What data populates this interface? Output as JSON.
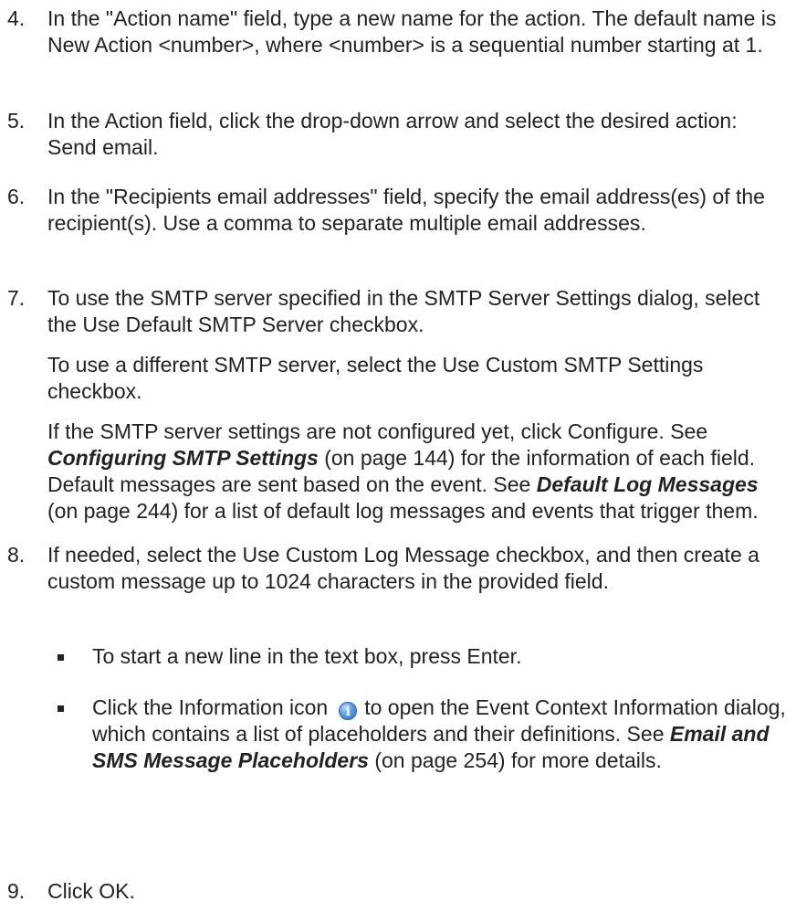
{
  "steps": [
    {
      "num": "4.",
      "paragraphs": [
        "In the \"Action name\" field, type a new name for the action. The default name is New Action <number>, where <number> is a sequential number starting at 1."
      ]
    },
    {
      "num": "5.",
      "paragraphs": [
        "In the Action field, click the drop-down arrow and select the desired action: Send email."
      ]
    },
    {
      "num": "6.",
      "paragraphs": [
        "In the \"Recipients email addresses\" field, specify the email address(es) of the recipient(s). Use a comma to separate multiple email addresses."
      ]
    },
    {
      "num": "7.",
      "paragraphs": [
        "To use the SMTP server specified in the SMTP Server Settings dialog, select the Use Default SMTP Server checkbox.",
        "To use a different SMTP server, select the Use Custom SMTP Settings checkbox."
      ],
      "config_para": {
        "t1": "If the SMTP server settings are not configured yet, click Configure. See ",
        "link1": "Configuring SMTP Settings",
        "t2": " (on page 144) for the information of each field. Default messages are sent based on the event. See ",
        "link2": "Default Log Messages",
        "t3": " (on page 244) for a list of default log messages and events that trigger them."
      }
    },
    {
      "num": "8.",
      "paragraphs": [
        "If needed, select the Use Custom Log Message checkbox, and then create a custom message up to 1024 characters in the provided field."
      ],
      "bullets": {
        "b1": "To start a new line in the text box, press Enter.",
        "b2_pre": "Click the Information icon",
        "b2_icon": "info-icon",
        "b2_post": "to open the Event Context Information dialog, which contains a list of placeholders and their definitions. See ",
        "b2_link": "Email and SMS Message Placeholders",
        "b2_tail": " (on page 254) for more details."
      }
    },
    {
      "num": "9.",
      "paragraphs": [
        "Click OK."
      ]
    }
  ],
  "colors": {
    "text": "#222222",
    "info_icon": "#4a8ee0"
  }
}
